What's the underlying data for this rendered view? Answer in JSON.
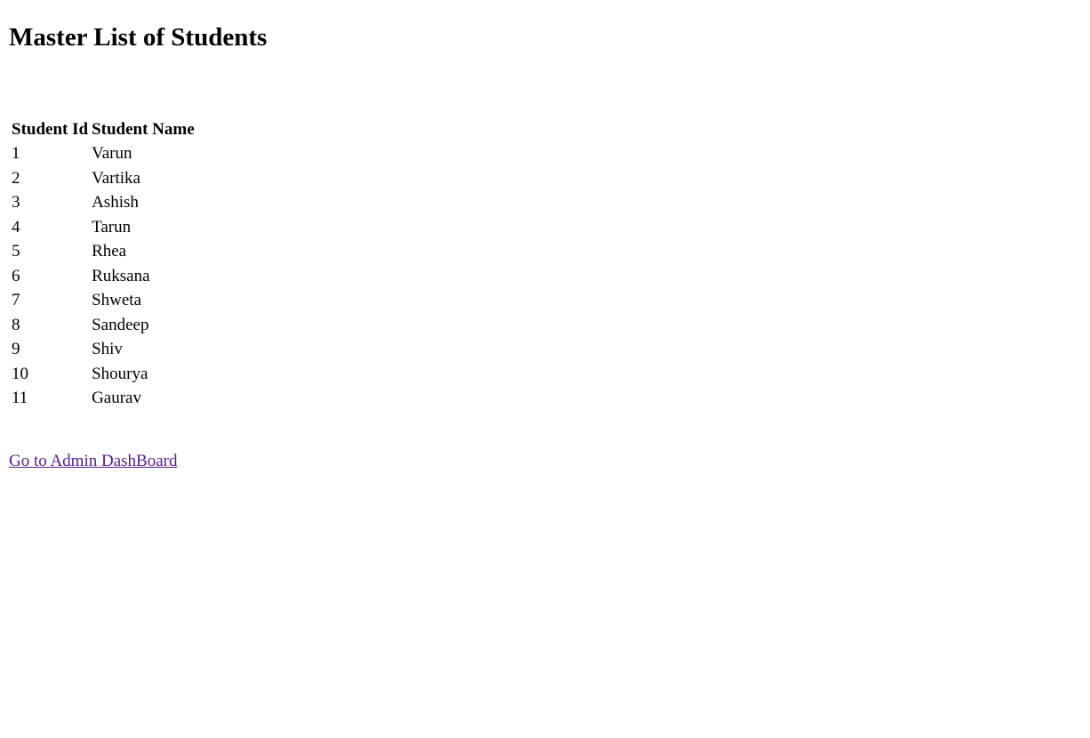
{
  "page": {
    "title": "Master List of Students"
  },
  "table": {
    "headers": [
      "Student Id",
      "Student Name"
    ],
    "rows": [
      [
        "1",
        "Varun"
      ],
      [
        "2",
        "Vartika"
      ],
      [
        "3",
        "Ashish"
      ],
      [
        "4",
        "Tarun"
      ],
      [
        "5",
        "Rhea"
      ],
      [
        "6",
        "Ruksana"
      ],
      [
        "7",
        "Shweta"
      ],
      [
        "8",
        "Sandeep"
      ],
      [
        "9",
        "Shiv"
      ],
      [
        "10",
        "Shourya"
      ],
      [
        "11",
        "Gaurav"
      ]
    ]
  },
  "footer": {
    "link_label": "Go to Admin DashBoard"
  },
  "colors": {
    "visited_link": "#551a8b",
    "text": "#000000",
    "background": "#ffffff"
  }
}
